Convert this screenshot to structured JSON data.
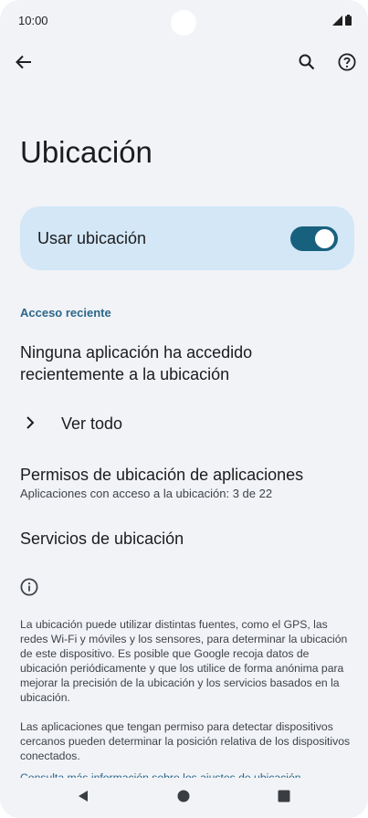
{
  "status_bar": {
    "time": "10:00"
  },
  "page": {
    "title": "Ubicación"
  },
  "main_switch": {
    "label": "Usar ubicación",
    "state": "on"
  },
  "recent": {
    "header": "Acceso reciente",
    "empty_text": "Ninguna aplicación ha accedido recientemente a la ubicación",
    "see_all": "Ver todo"
  },
  "permissions": {
    "title": "Permisos de ubicación de aplicaciones",
    "summary": "Aplicaciones con acceso a la ubicación: 3 de 22"
  },
  "services": {
    "title": "Servicios de ubicación"
  },
  "footer": {
    "p1": "La ubicación puede utilizar distintas fuentes, como el GPS, las redes Wi-Fi y móviles y los sensores, para determinar la ubicación de este dispositivo. Es posible que Google recoja datos de ubicación periódicamente y que los utilice de forma anónima para mejorar la precisión de la ubicación y los servicios basados en la ubicación.",
    "p2": "Las aplicaciones que tengan permiso para detectar dispositivos cercanos pueden determinar la posición relativa de los dispositivos conectados.",
    "link": "Consulta más información sobre los ajustes de ubicación"
  },
  "colors": {
    "background": "#f1f3f7",
    "card": "#d3e7f7",
    "accent": "#18617e",
    "link": "#2b6789"
  },
  "icons": [
    "back-arrow-icon",
    "search-icon",
    "help-icon",
    "chevron-right-icon",
    "info-icon",
    "nav-back-icon",
    "nav-home-icon",
    "nav-recents-icon"
  ]
}
